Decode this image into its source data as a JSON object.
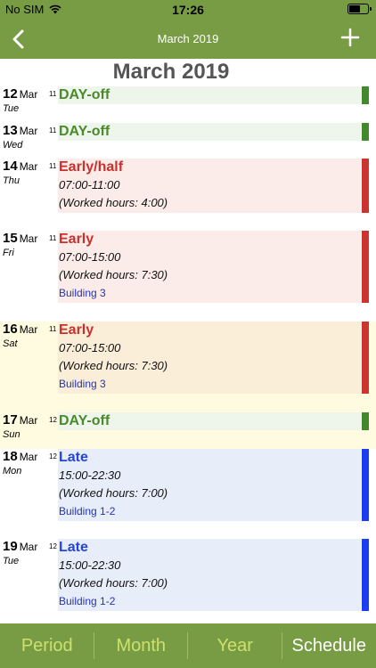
{
  "status": {
    "carrier": "No SIM",
    "time": "17:26"
  },
  "nav": {
    "title": "March 2019"
  },
  "month_title": "March 2019",
  "days": [
    {
      "day": "12",
      "mon": "Mar",
      "dow": "Tue",
      "week": "11",
      "shift": "DAY-off"
    },
    {
      "day": "13",
      "mon": "Mar",
      "dow": "Wed",
      "week": "11",
      "shift": "DAY-off"
    },
    {
      "day": "14",
      "mon": "Mar",
      "dow": "Thu",
      "week": "11",
      "shift": "Early/half",
      "time": "07:00-11:00",
      "hours": "(Worked hours: 4:00)"
    },
    {
      "day": "15",
      "mon": "Mar",
      "dow": "Fri",
      "week": "11",
      "shift": "Early",
      "time": "07:00-15:00",
      "hours": "(Worked hours: 7:30)",
      "location": "Building 3"
    },
    {
      "day": "16",
      "mon": "Mar",
      "dow": "Sat",
      "week": "11",
      "shift": "Early",
      "time": "07:00-15:00",
      "hours": "(Worked hours: 7:30)",
      "location": "Building 3"
    },
    {
      "day": "17",
      "mon": "Mar",
      "dow": "Sun",
      "week": "12",
      "shift": "DAY-off"
    },
    {
      "day": "18",
      "mon": "Mar",
      "dow": "Mon",
      "week": "12",
      "shift": "Late",
      "time": "15:00-22:30",
      "hours": "(Worked hours: 7:00)",
      "location": "Building 1-2"
    },
    {
      "day": "19",
      "mon": "Mar",
      "dow": "Tue",
      "week": "12",
      "shift": "Late",
      "time": "15:00-22:30",
      "hours": "(Worked hours: 7:00)",
      "location": "Building 1-2"
    }
  ],
  "tabs": [
    {
      "label": "Period"
    },
    {
      "label": "Month"
    },
    {
      "label": "Year"
    },
    {
      "label": "Schedule"
    }
  ],
  "colors": {
    "header": "#789c44",
    "off": "#44882e",
    "early": "#cc3430",
    "late": "#1b3ff0"
  },
  "icons": {
    "back": "chevron-left-icon",
    "add": "plus-icon",
    "wifi": "wifi-icon",
    "battery": "battery-icon"
  }
}
